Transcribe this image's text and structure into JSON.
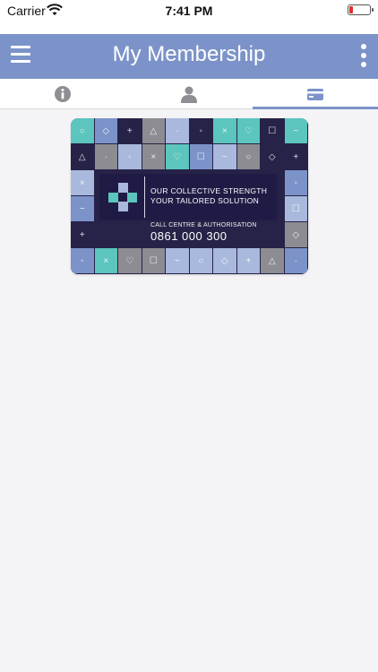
{
  "status_bar": {
    "carrier": "Carrier",
    "time": "7:41 PM",
    "battery_level": 0.15,
    "battery_color": "#e0302e"
  },
  "nav_bar": {
    "title": "My Membership",
    "left_icon": "menu-icon",
    "right_icon": "more-vertical-icon",
    "background_color": "#7c93c9"
  },
  "tabs": [
    {
      "icon": "info-icon",
      "active": false
    },
    {
      "icon": "person-icon",
      "active": false
    },
    {
      "icon": "credit-card-icon",
      "active": true
    }
  ],
  "card": {
    "slogan_line1": "OUR COLLECTIVE STRENGTH",
    "slogan_line2": "YOUR TAILORED SOLUTION",
    "contact_label": "CALL CENTRE & AUTHORISATION",
    "contact_number": "0861 000 300",
    "colors": {
      "navy": "#262248",
      "teal": "#5cc5bd",
      "blue": "#7c93c9",
      "grey": "#8c8c92",
      "light_blue": "#a9b9dd"
    }
  }
}
